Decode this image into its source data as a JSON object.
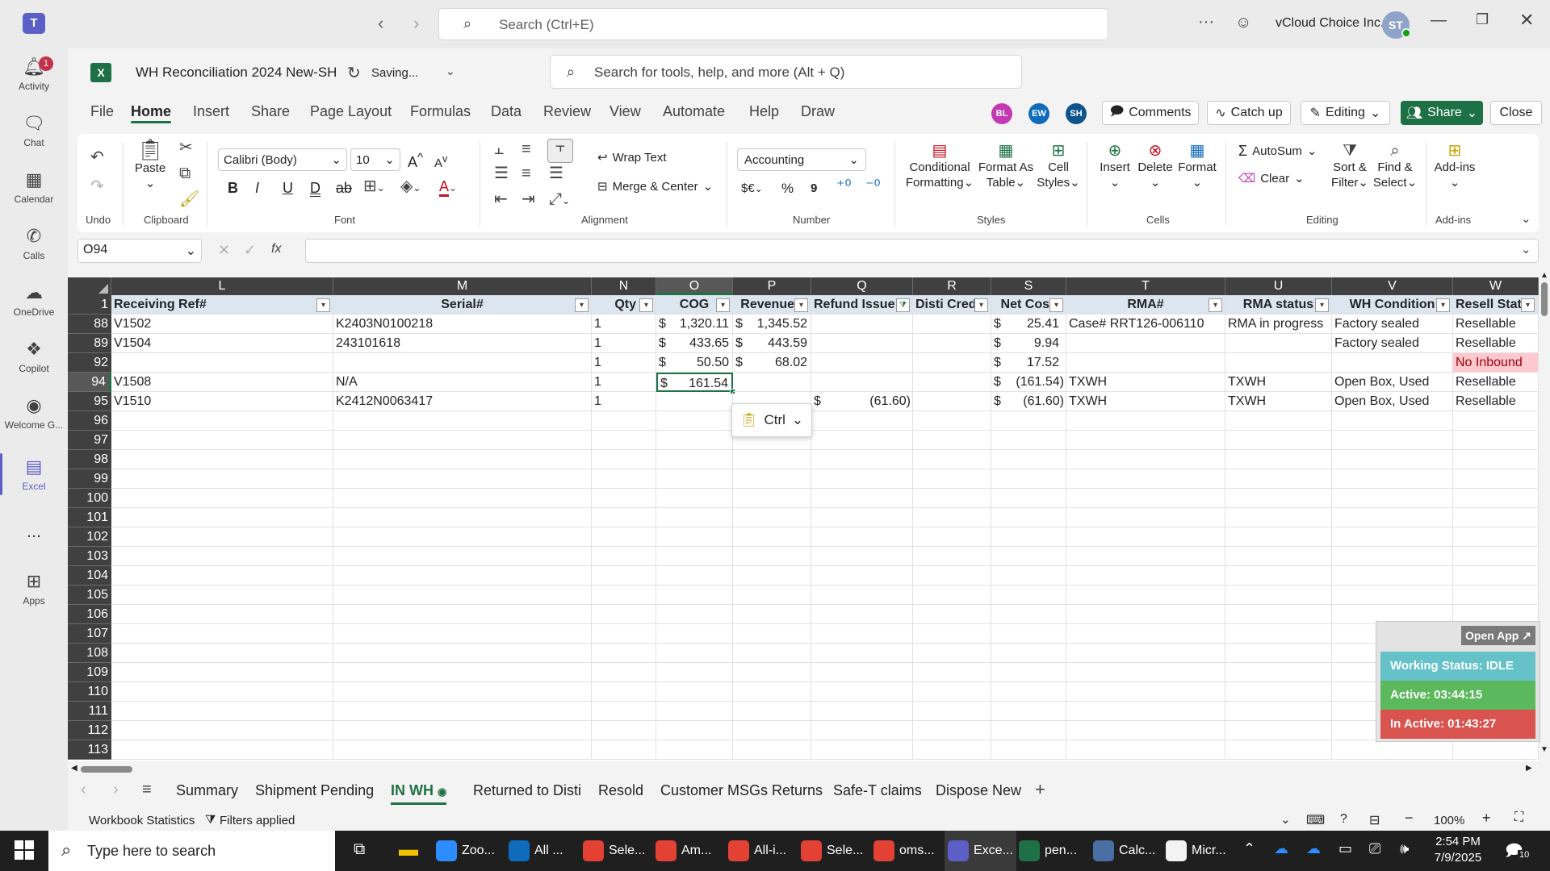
{
  "teams": {
    "search_placeholder": "Search (Ctrl+E)",
    "org_name": "vCloud Choice Inc.",
    "user_initials": "ST",
    "rail": [
      {
        "label": "Activity",
        "badge": "1"
      },
      {
        "label": "Chat"
      },
      {
        "label": "Calendar"
      },
      {
        "label": "Calls"
      },
      {
        "label": "OneDrive"
      },
      {
        "label": "Copilot"
      },
      {
        "label": "Welcome G..."
      },
      {
        "label": "Excel"
      },
      {
        "label": "..."
      },
      {
        "label": "Apps"
      }
    ]
  },
  "excel": {
    "file_name": "WH Reconciliation 2024 New-SH",
    "save_status": "Saving...",
    "tools_search_placeholder": "Search for tools, help, and more (Alt + Q)",
    "tabs": [
      "File",
      "Home",
      "Insert",
      "Share",
      "Page Layout",
      "Formulas",
      "Data",
      "Review",
      "View",
      "Automate",
      "Help",
      "Draw"
    ],
    "collaborators": [
      {
        "initials": "BL",
        "color": "#c239b3"
      },
      {
        "initials": "EW",
        "color": "#0f6cbd"
      },
      {
        "initials": "SH",
        "color": "#0f548c"
      }
    ],
    "buttons": {
      "comments": "Comments",
      "catchup": "Catch up",
      "editing": "Editing",
      "share": "Share",
      "close": "Close"
    },
    "ribbon": {
      "undo_label": "Undo",
      "paste": "Paste",
      "clipboard_label": "Clipboard",
      "font_name": "Calibri (Body)",
      "font_size": "10",
      "font_label": "Font",
      "wrap_text": "Wrap Text",
      "merge_center": "Merge & Center",
      "alignment_label": "Alignment",
      "number_format": "Accounting",
      "number_label": "Number",
      "currency": "$€",
      "percent": "%",
      "comma": "9",
      "cond_fmt_1": "Conditional",
      "cond_fmt_2": "Formatting",
      "fmt_table_1": "Format As",
      "fmt_table_2": "Table",
      "cell_styles_1": "Cell",
      "cell_styles_2": "Styles",
      "styles_label": "Styles",
      "insert": "Insert",
      "delete": "Delete",
      "format": "Format",
      "cells_label": "Cells",
      "autosum": "AutoSum",
      "clear": "Clear",
      "sort_filter_1": "Sort &",
      "sort_filter_2": "Filter",
      "find_select_1": "Find &",
      "find_select_2": "Select",
      "editing_label": "Editing",
      "addins": "Add-ins",
      "addins_label": "Add-ins"
    },
    "name_box": "O94",
    "fx": "fx",
    "columns": [
      "L",
      "M",
      "N",
      "O",
      "P",
      "Q",
      "R",
      "S",
      "T",
      "U",
      "V",
      "W"
    ],
    "header_row": {
      "row": "1",
      "cells": [
        "Receiving Ref#",
        "Serial#",
        "Qty",
        "COG",
        "Revenue",
        "Refund Issue",
        "Disti Cred",
        "Net Cos",
        "RMA#",
        "RMA status",
        "WH Condition",
        "Resell Stat"
      ]
    },
    "rows": [
      {
        "row": "88",
        "cells": [
          "V1502",
          "K2403N0100218",
          "1",
          "$",
          "1,320.11",
          "$",
          "1,345.52",
          "",
          "",
          "$",
          "25.41",
          "Case# RRT126-006110",
          "RMA in progress",
          "Factory sealed",
          "Resellable"
        ]
      },
      {
        "row": "89",
        "cells": [
          "V1504",
          "243101618",
          "1",
          "$",
          "433.65",
          "$",
          "443.59",
          "",
          "",
          "$",
          "9.94",
          "",
          "",
          "Factory sealed",
          "Resellable"
        ]
      },
      {
        "row": "92",
        "cells": [
          "",
          "",
          "1",
          "$",
          "50.50",
          "$",
          "68.02",
          "",
          "",
          "$",
          "17.52",
          "",
          "",
          "",
          "No Inbound"
        ]
      },
      {
        "row": "94",
        "cells": [
          "V1508",
          "N/A",
          "1",
          "$",
          "161.54",
          "",
          "",
          "",
          "",
          "$",
          "(161.54)",
          "TXWH",
          "TXWH",
          "Open Box, Used",
          "Resellable"
        ]
      },
      {
        "row": "95",
        "cells": [
          "V1510",
          "K2412N0063417",
          "1",
          "",
          "",
          "",
          "",
          "$",
          "(61.60)",
          "$",
          "(61.60)",
          "TXWH",
          "TXWH",
          "Open Box, Used",
          "Resellable"
        ]
      }
    ],
    "empty_rows": [
      "96",
      "97",
      "98",
      "99",
      "100",
      "101",
      "102",
      "103",
      "104",
      "105",
      "106",
      "107",
      "108",
      "109",
      "110",
      "111",
      "112",
      "113"
    ],
    "paste_popup": "Ctrl",
    "sheets": [
      "Summary",
      "Shipment Pending",
      "IN WH",
      "Returned to Disti",
      "Resold",
      "Customer MSGs Returns",
      "Safe-T claims",
      "Dispose New"
    ],
    "active_sheet": "IN WH",
    "status_left": "Workbook Statistics",
    "status_filters": "Filters applied",
    "zoom": "100%"
  },
  "widget": {
    "open_app": "Open App",
    "working_status": "Working Status: IDLE",
    "active": "Active: 03:44:15",
    "inactive": "In Active: 01:43:27"
  },
  "taskbar": {
    "search_placeholder": "Type here to search",
    "apps": [
      {
        "label": "Zoo...",
        "color": "#2d8cff"
      },
      {
        "label": "All ...",
        "color": "#0f6cbd"
      },
      {
        "label": "Sele...",
        "color": "#e34133"
      },
      {
        "label": "Am...",
        "color": "#e34133"
      },
      {
        "label": "All-i...",
        "color": "#e34133"
      },
      {
        "label": "Sele...",
        "color": "#e34133"
      },
      {
        "label": "oms...",
        "color": "#e34133"
      },
      {
        "label": "Exce...",
        "color": "#5b5fc7"
      },
      {
        "label": "pen...",
        "color": "#1e7145"
      },
      {
        "label": "Calc...",
        "color": "#4a6fa5"
      },
      {
        "label": "Micr...",
        "color": "#f3f3f3"
      }
    ],
    "time": "2:54 PM",
    "date": "7/9/2025",
    "notif": "10"
  }
}
